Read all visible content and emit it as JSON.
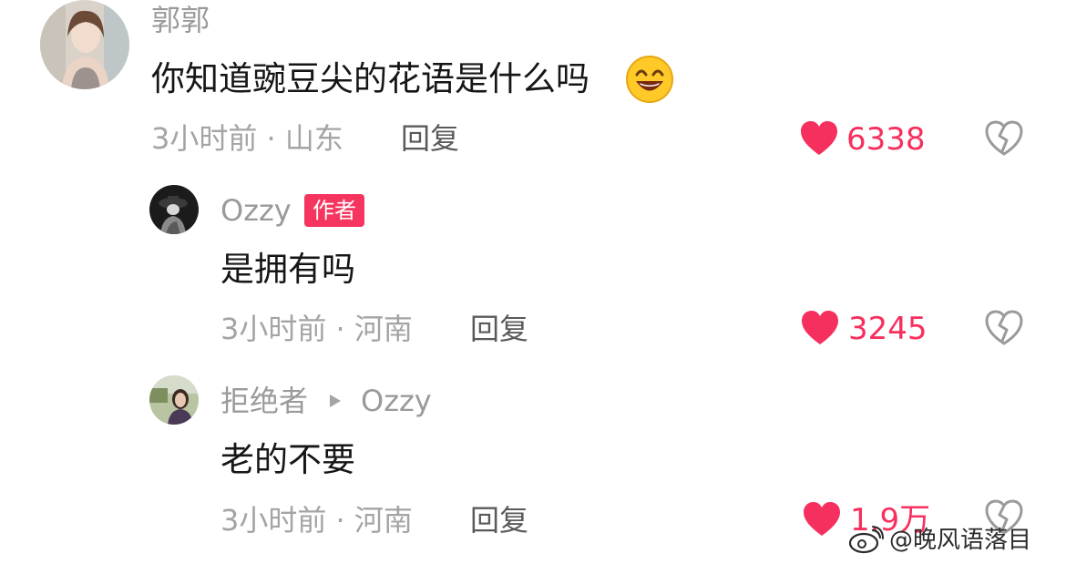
{
  "comments": [
    {
      "username": "郭郭",
      "text": "你知道豌豆尖的花语是什么吗",
      "emoji": "laughing-emoji",
      "time_location": "3小时前 · 山东",
      "reply_label": "回复",
      "likes": "6338"
    },
    {
      "username": "Ozzy",
      "badge": "作者",
      "text": "是拥有吗",
      "time_location": "3小时前 · 河南",
      "reply_label": "回复",
      "likes": "3245"
    },
    {
      "username": "拒绝者",
      "reply_to": "Ozzy",
      "text": "老的不要",
      "time_location": "3小时前 · 河南",
      "reply_label": "回复",
      "likes": "1.9万"
    }
  ],
  "icons": {
    "like": "heart-icon",
    "dislike": "broken-heart-icon",
    "reply_arrow": "triangle-right-icon"
  },
  "colors": {
    "like": "#f6305e",
    "badge": "#f5355f",
    "meta": "#a4a4a4"
  },
  "watermark": "@晚风语落目"
}
